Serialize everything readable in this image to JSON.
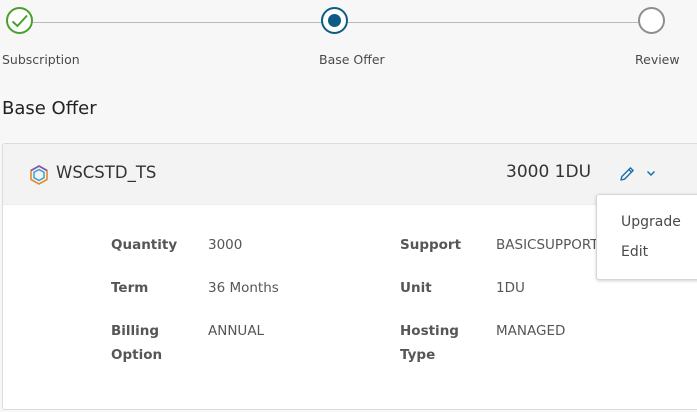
{
  "stepper": {
    "steps": [
      {
        "label": "Subscription",
        "state": "completed"
      },
      {
        "label": "Base Offer",
        "state": "current"
      },
      {
        "label": "Review",
        "state": "upcoming"
      }
    ]
  },
  "section": {
    "title": "Base Offer"
  },
  "offer": {
    "name": "WSCSTD_TS",
    "summary": "3000 1DU",
    "details": {
      "quantity_label": "Quantity",
      "quantity_value": "3000",
      "term_label": "Term",
      "term_value": "36 Months",
      "billing_label_line1": "Billing",
      "billing_label_line2": "Option",
      "billing_value": "ANNUAL",
      "support_label": "Support",
      "support_value": "BASICSUPPORT",
      "unit_label": "Unit",
      "unit_value": "1DU",
      "hosting_label_line1": "Hosting",
      "hosting_label_line2": "Type",
      "hosting_value": "MANAGED"
    }
  },
  "dropdown": {
    "items": [
      {
        "label": "Upgrade"
      },
      {
        "label": "Edit"
      }
    ]
  },
  "colors": {
    "completed": "#47a02b",
    "current": "#0d5c85",
    "upcoming": "#8e8e8e",
    "action": "#1b6fa8"
  },
  "icons": {
    "completed_step": "check-icon",
    "product": "hexagon-logo-icon",
    "edit": "pencil-icon",
    "menu": "chevron-down-icon"
  }
}
